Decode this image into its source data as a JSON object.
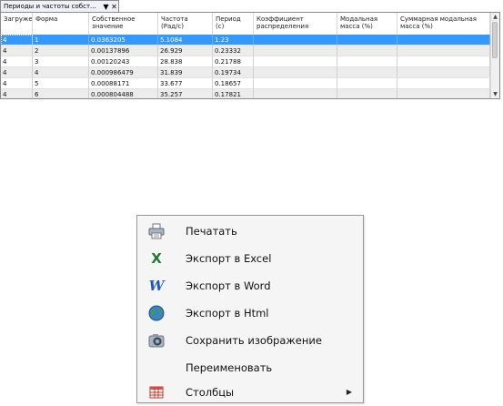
{
  "panel": {
    "tab_title": "Периоды и частоты собст...",
    "pin_glyph": "▼",
    "close_glyph": "✕"
  },
  "table": {
    "columns": [
      "Загружение",
      "Форма",
      "Собственное\nзначение",
      "Частота\n(Рад/с)",
      "Период\n(с)",
      "Коэффициент\nраспределения",
      "Модальная\nмасса (%)",
      "Суммарная модальная\nмасса (%)"
    ],
    "rows": [
      [
        "4",
        "1",
        "0.0363205",
        "5.1084",
        "1.23",
        "",
        "",
        ""
      ],
      [
        "4",
        "2",
        "0.00137896",
        "26.929",
        "0.23332",
        "",
        "",
        ""
      ],
      [
        "4",
        "3",
        "0.00120243",
        "28.838",
        "0.21788",
        "",
        "",
        ""
      ],
      [
        "4",
        "4",
        "0.000986479",
        "31.839",
        "0.19734",
        "",
        "",
        ""
      ],
      [
        "4",
        "5",
        "0.00088171",
        "33.677",
        "0.18657",
        "",
        "",
        ""
      ],
      [
        "4",
        "6",
        "0.000804488",
        "35.257",
        "0.17821",
        "",
        "",
        ""
      ]
    ],
    "selected_row_index": 0
  },
  "menu": {
    "items": [
      {
        "label": "Печатать",
        "icon": "printer-icon"
      },
      {
        "label": "Экспорт в Excel",
        "icon": "excel-icon",
        "glyph": "X"
      },
      {
        "label": "Экспорт в Word",
        "icon": "word-icon",
        "glyph": "W"
      },
      {
        "label": "Экспорт в Html",
        "icon": "globe-icon"
      },
      {
        "label": "Сохранить изображение",
        "icon": "camera-icon"
      },
      {
        "label": "Переименовать",
        "icon": ""
      },
      {
        "label": "Столбцы",
        "icon": "table-columns-icon"
      }
    ],
    "submenu_arrow": "▶"
  },
  "colors": {
    "selection": "#3399ff",
    "alt_row": "#ececec",
    "menu_bg": "#f5f5f5"
  }
}
